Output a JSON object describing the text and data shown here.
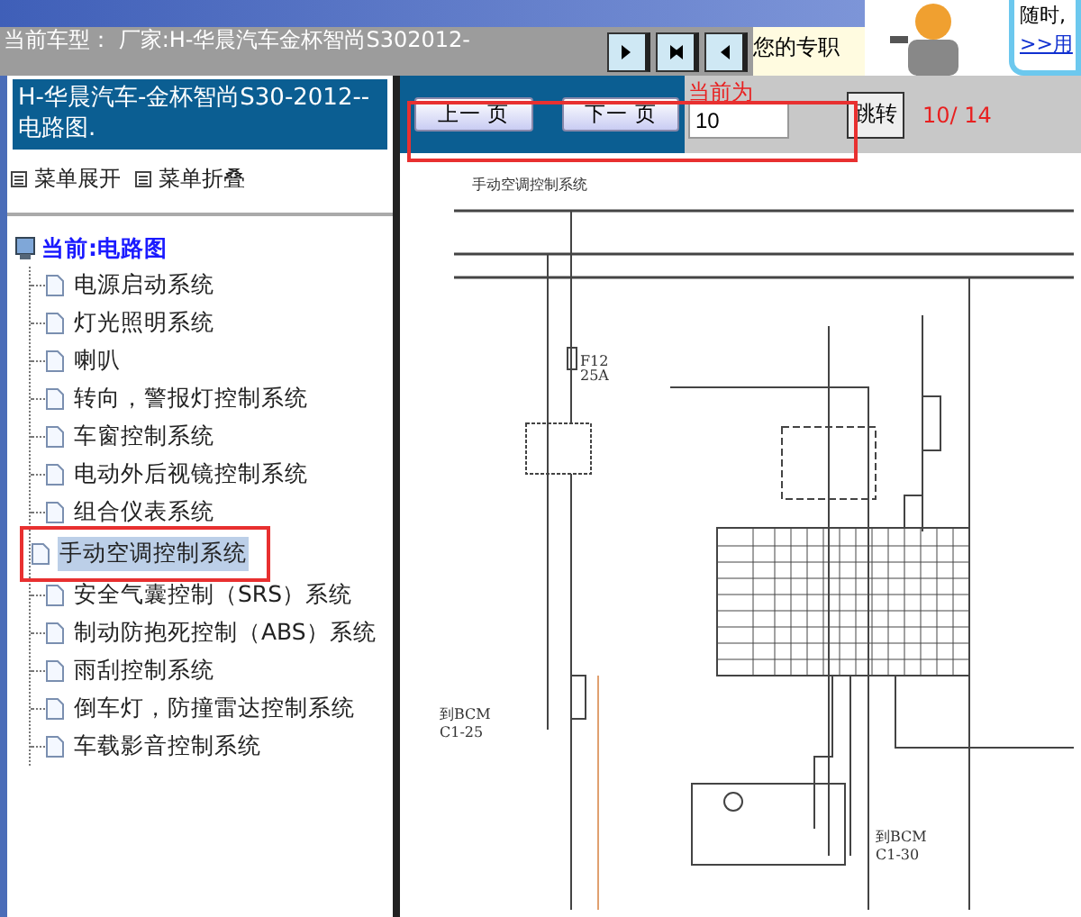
{
  "header": {
    "car_model": "当前车型： 厂家:H-华晨汽车金杯智尚S302012-",
    "notice": "您的专职",
    "promo_lines": [
      "随时,",
      ">>用"
    ]
  },
  "sidebar": {
    "title": "H-华晨汽车-金杯智尚S30-2012-- 电路图.",
    "menu_actions": [
      "菜单展开",
      "菜单折叠"
    ],
    "tree": {
      "label": "当前:电路图",
      "expanded": true,
      "children": [
        {
          "label": "电源启动系统",
          "selected": false
        },
        {
          "label": "灯光照明系统",
          "selected": false
        },
        {
          "label": "喇叭",
          "selected": false
        },
        {
          "label": "转向，警报灯控制系统",
          "selected": false
        },
        {
          "label": "车窗控制系统",
          "selected": false
        },
        {
          "label": "电动外后视镜控制系统",
          "selected": false
        },
        {
          "label": "组合仪表系统",
          "selected": false
        },
        {
          "label": "手动空调控制系统",
          "selected": true
        },
        {
          "label": "安全气囊控制（SRS）系统",
          "selected": false
        },
        {
          "label": "制动防抱死控制（ABS）系统",
          "selected": false
        },
        {
          "label": "雨刮控制系统",
          "selected": false
        },
        {
          "label": "倒车灯，防撞雷达控制系统",
          "selected": false
        },
        {
          "label": "车载影音控制系统",
          "selected": false
        }
      ]
    }
  },
  "pager": {
    "prev": "上一 页",
    "next": "下一 页",
    "current_label": "当前为",
    "current_value": "10",
    "jump": "跳转",
    "page_count": "10/ 14"
  },
  "diagram": {
    "title": "手动空调控制系统",
    "labels": [
      "F12",
      "25A",
      "到BCM",
      "C1-25",
      "到BCM",
      "C1-30"
    ]
  }
}
